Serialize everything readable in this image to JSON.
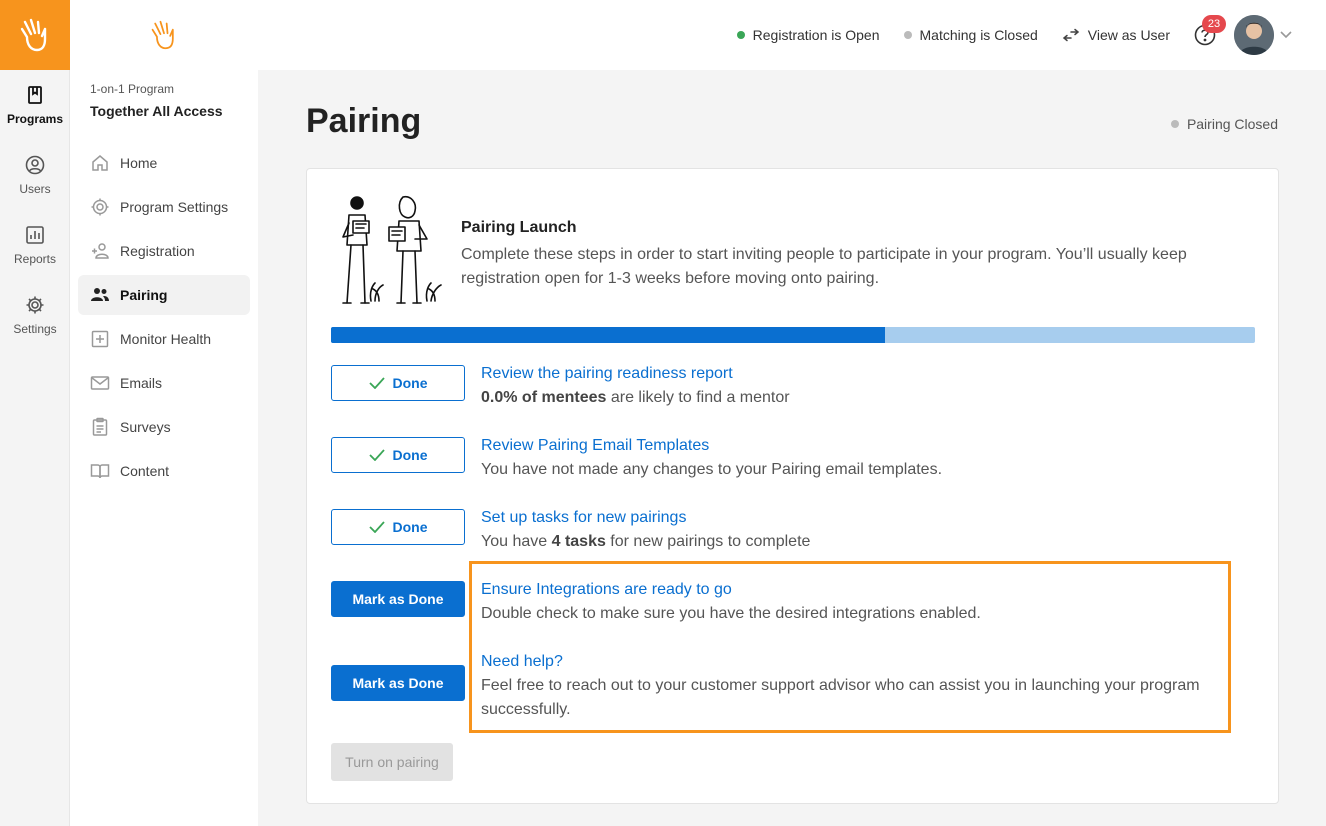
{
  "colors": {
    "accent": "#f7941d",
    "primary": "#0a6fd0",
    "open": "#3aa657",
    "closed": "#bbbbbb",
    "badge": "#e5484d"
  },
  "rail": {
    "items": [
      {
        "label": "Programs",
        "icon": "book-icon",
        "active": true
      },
      {
        "label": "Users",
        "icon": "user-circle-icon"
      },
      {
        "label": "Reports",
        "icon": "chart-icon"
      },
      {
        "label": "Settings",
        "icon": "gear-icon"
      }
    ]
  },
  "sidebar": {
    "program_label": "1-on-1 Program",
    "program_name": "Together All Access",
    "items": [
      {
        "label": "Home",
        "icon": "home-icon"
      },
      {
        "label": "Program Settings",
        "icon": "gear-icon"
      },
      {
        "label": "Registration",
        "icon": "add-user-icon"
      },
      {
        "label": "Pairing",
        "icon": "users-icon",
        "active": true
      },
      {
        "label": "Monitor Health",
        "icon": "plus-square-icon"
      },
      {
        "label": "Emails",
        "icon": "mail-icon"
      },
      {
        "label": "Surveys",
        "icon": "clipboard-icon"
      },
      {
        "label": "Content",
        "icon": "book-open-icon"
      }
    ]
  },
  "topbar": {
    "registration_status": "Registration is Open",
    "matching_status": "Matching is Closed",
    "view_as_user": "View as User",
    "notifications": "23"
  },
  "page": {
    "title": "Pairing",
    "status": "Pairing Closed"
  },
  "launch": {
    "title": "Pairing Launch",
    "description": "Complete these steps in order to start inviting people to participate in your program. You’ll usually keep registration open for 1-3 weeks before moving onto pairing.",
    "progress": 0.6
  },
  "steps": [
    {
      "button": "Done",
      "title": "Review the pairing readiness report",
      "desc_bold": "0.0% of mentees",
      "desc_after": " are likely to find a mentor"
    },
    {
      "button": "Done",
      "title": "Review Pairing Email Templates",
      "desc": "You have not made any changes to your Pairing email templates."
    },
    {
      "button": "Done",
      "title": "Set up tasks for new pairings",
      "desc_before": "You have ",
      "desc_bold": "4 tasks",
      "desc_after": " for new pairings to complete"
    },
    {
      "button": "Mark as Done",
      "title": "Ensure Integrations are ready to go",
      "desc": "Double check to make sure you have the desired integrations enabled."
    },
    {
      "button": "Mark as Done",
      "title": "Need help?",
      "desc": "Feel free to reach out to your customer support advisor who can assist you in launching your program successfully."
    }
  ],
  "turn_on_label": "Turn on pairing"
}
